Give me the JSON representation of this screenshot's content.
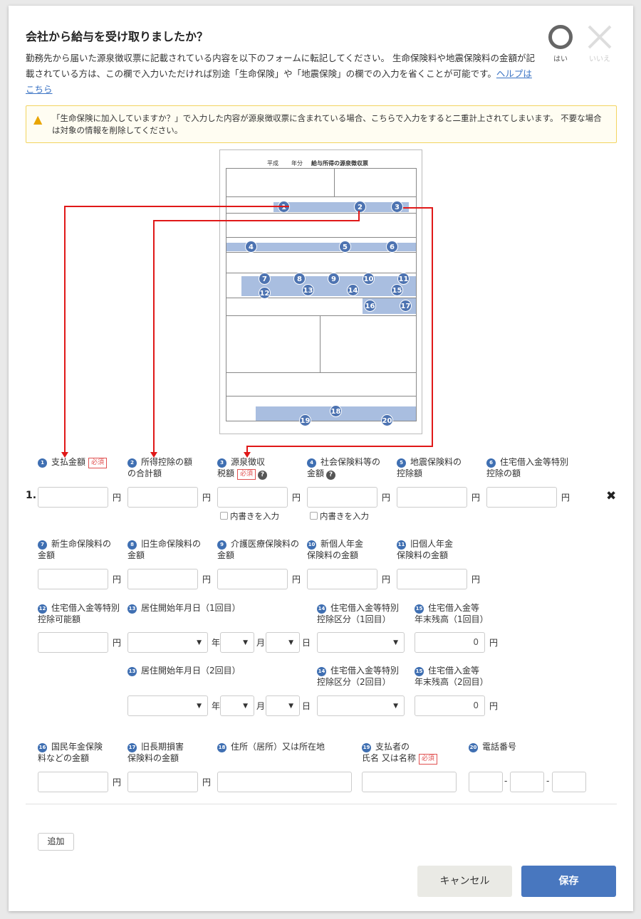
{
  "dialog": {
    "title": "会社から給与を受け取りましたか？",
    "description": "勤務先から届いた源泉徴収票に記載されている内容を以下のフォームに転記してください。 生命保険料や地震保険料の金額が記載されている方は、この欄で入力いただければ別途「生命保険」や「地震保険」の欄での入力を省くことが可能です。",
    "help_link": "ヘルプはこちら",
    "answer_yes": "はい",
    "answer_no": "いいえ",
    "warning": "「生命保険に加入していますか？」で入力した内容が源泉徴収票に含まれている場合、こちらで入力をすると二重計上されてしまいます。 不要な場合は対象の情報を削除してください。"
  },
  "document": {
    "heading_era": "平成",
    "heading_year": "年分",
    "heading_title": "給与所得の源泉徴収票",
    "markers": [
      "1",
      "2",
      "3",
      "4",
      "5",
      "6",
      "7",
      "8",
      "9",
      "10",
      "11",
      "12",
      "13",
      "14",
      "15",
      "16",
      "17",
      "18",
      "19",
      "20"
    ]
  },
  "form": {
    "row_number": "1.",
    "required_badge": "必須",
    "help_icon": "?",
    "unit_yen": "円",
    "unit_year": "年",
    "unit_month": "月",
    "unit_day": "日",
    "handwrite_label": "内書きを入力",
    "dash": "-",
    "balance_value_1": "0",
    "balance_value_2": "0",
    "fields": {
      "f1": {
        "num": "1",
        "label": "支払金額"
      },
      "f2": {
        "num": "2",
        "label": "所得控除の額\nの合計額"
      },
      "f3": {
        "num": "3",
        "label": "源泉徴収\n税額"
      },
      "f4": {
        "num": "4",
        "label": "社会保険料等の\n金額"
      },
      "f5": {
        "num": "5",
        "label": "地震保険料の\n控除額"
      },
      "f6": {
        "num": "6",
        "label": "住宅借入金等特別\n控除の額"
      },
      "f7": {
        "num": "7",
        "label": "新生命保険料の\n金額"
      },
      "f8": {
        "num": "8",
        "label": "旧生命保険料の\n金額"
      },
      "f9": {
        "num": "9",
        "label": "介護医療保険料の\n金額"
      },
      "f10": {
        "num": "10",
        "label": "新個人年金\n保険料の金額"
      },
      "f11": {
        "num": "11",
        "label": "旧個人年金\n保険料の金額"
      },
      "f12": {
        "num": "12",
        "label": "住宅借入金等特別\n控除可能額"
      },
      "f13a": {
        "num": "13",
        "label": "居住開始年月日（1回目）"
      },
      "f14a": {
        "num": "14",
        "label": "住宅借入金等特別\n控除区分（1回目）"
      },
      "f15a": {
        "num": "15",
        "label": "住宅借入金等\n年末残高（1回目）"
      },
      "f13b": {
        "num": "13",
        "label": "居住開始年月日（2回目）"
      },
      "f14b": {
        "num": "14",
        "label": "住宅借入金等特別\n控除区分（2回目）"
      },
      "f15b": {
        "num": "15",
        "label": "住宅借入金等\n年末残高（2回目）"
      },
      "f16": {
        "num": "16",
        "label": "国民年金保険\n料などの金額"
      },
      "f17": {
        "num": "17",
        "label": "旧長期損害\n保険料の金額"
      },
      "f18": {
        "num": "18",
        "label": "住所（居所）又は所在地"
      },
      "f19": {
        "num": "19",
        "label": "支払者の\n氏名 又は名称"
      },
      "f20": {
        "num": "20",
        "label": "電話番号"
      }
    }
  },
  "actions": {
    "add": "追加",
    "cancel": "キャンセル",
    "save": "保存"
  },
  "colors": {
    "accent": "#4877bf",
    "marker": "#4d73b1",
    "required": "#e05050",
    "arrow": "#e01818",
    "warning_border": "#f3d460"
  }
}
